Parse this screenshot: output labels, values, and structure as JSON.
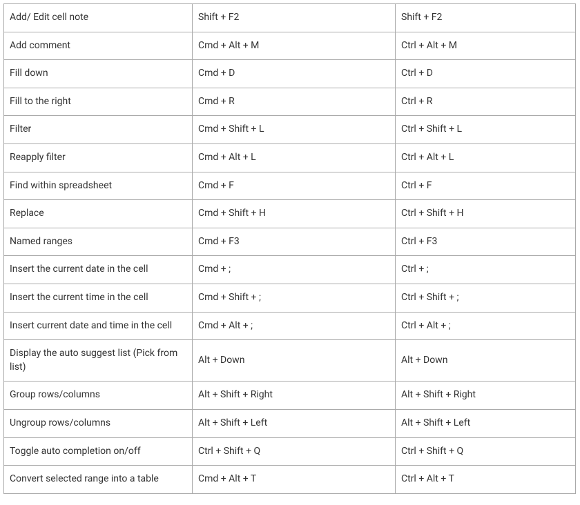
{
  "shortcuts": [
    {
      "action": "Add/ Edit cell note",
      "mac": "Shift + F2",
      "win": "Shift + F2"
    },
    {
      "action": "Add comment",
      "mac": "Cmd + Alt + M",
      "win": "Ctrl + Alt + M"
    },
    {
      "action": "Fill down",
      "mac": "Cmd + D",
      "win": "Ctrl + D"
    },
    {
      "action": "Fill to the right",
      "mac": "Cmd + R",
      "win": "Ctrl + R"
    },
    {
      "action": "Filter",
      "mac": "Cmd + Shift + L",
      "win": "Ctrl + Shift + L"
    },
    {
      "action": "Reapply filter",
      "mac": "Cmd + Alt + L",
      "win": "Ctrl + Alt + L"
    },
    {
      "action": "Find within spreadsheet",
      "mac": "Cmd + F",
      "win": "Ctrl + F"
    },
    {
      "action": "Replace",
      "mac": "Cmd + Shift + H",
      "win": "Ctrl + Shift + H"
    },
    {
      "action": "Named ranges",
      "mac": "Cmd + F3",
      "win": "Ctrl + F3"
    },
    {
      "action": "Insert the current date in the cell",
      "mac": "Cmd + ;",
      "win": "Ctrl + ;"
    },
    {
      "action": "Insert the current time in the cell",
      "mac": "Cmd + Shift + ;",
      "win": "Ctrl + Shift + ;"
    },
    {
      "action": "Insert current date and time in the cell",
      "mac": "Cmd + Alt + ;",
      "win": "Ctrl + Alt + ;"
    },
    {
      "action": "Display the auto suggest list (Pick from list)",
      "mac": "Alt + Down",
      "win": "Alt + Down"
    },
    {
      "action": "Group rows/columns",
      "mac": "Alt + Shift + Right",
      "win": "Alt + Shift + Right"
    },
    {
      "action": "Ungroup rows/columns",
      "mac": "Alt + Shift + Left",
      "win": "Alt + Shift + Left"
    },
    {
      "action": "Toggle auto completion on/off",
      "mac": "Ctrl + Shift + Q",
      "win": "Ctrl + Shift + Q"
    },
    {
      "action": "Convert selected range into a table",
      "mac": "Cmd + Alt + T",
      "win": "Ctrl + Alt + T"
    }
  ]
}
